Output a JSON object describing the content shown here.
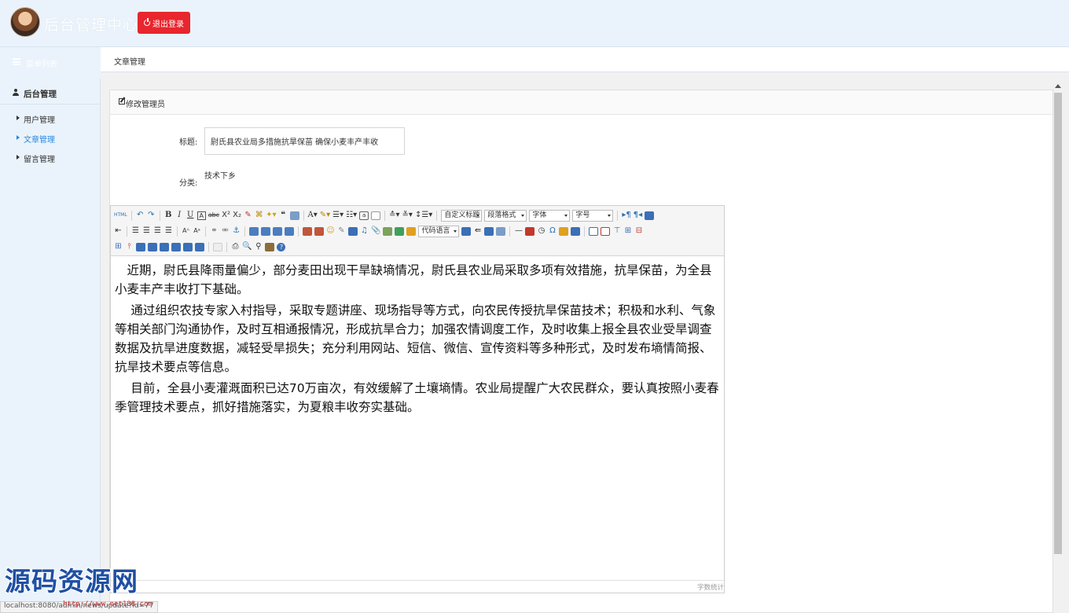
{
  "header": {
    "app_title": "后台管理中心",
    "logout_label": "退出登录",
    "logout_color": "#e7262e"
  },
  "sidebar_header": {
    "label": "菜单列表"
  },
  "breadcrumb": {
    "current": "文章管理"
  },
  "sidebar": {
    "section_label": "后台管理",
    "items": [
      {
        "label": "用户管理",
        "active": false
      },
      {
        "label": "文章管理",
        "active": true
      },
      {
        "label": "留言管理",
        "active": false
      }
    ],
    "active_color": "#2a8ae0"
  },
  "panel": {
    "title": "修改管理员"
  },
  "form": {
    "title_label": "标题:",
    "title_value": "尉氏县农业局多措施抗旱保苗 确保小麦丰产丰收",
    "category_label": "分类:",
    "category_value": "技术下乡"
  },
  "editor": {
    "toolbar": {
      "html_label": "HTML",
      "custom_title": "自定义标题",
      "paragraph_format": "段落格式",
      "font_family": "字体",
      "font_size": "字号",
      "code_language": "代码语言"
    },
    "paragraphs": [
      "　近期，尉氏县降雨量偏少，部分麦田出现干旱缺墒情况，尉氏县农业局采取多项有效措施，抗旱保苗，为全县小麦丰产丰收打下基础。",
      "　 通过组织农技专家入村指导，采取专题讲座、现场指导等方式，向农民传授抗旱保苗技术；积极和水利、气象等相关部门沟通协作，及时互相通报情况，形成抗旱合力；加强农情调度工作，及时收集上报全县农业受旱调查数据及抗旱进度数据，减轻受旱损失；充分利用网站、短信、微信、宣传资料等多种形式，及时发布墒情简报、抗旱技术要点等信息。",
      "　 目前，全县小麦灌溉面积已达70万亩次，有效缓解了土壤墒情。农业局提醒广大农民群众，要认真按照小麦春季管理技术要点，抓好措施落实，为夏粮丰收夯实基础。"
    ],
    "word_count_label": "字数统计"
  },
  "watermark": {
    "text": "源码资源网",
    "url": "http://www.net188.com"
  },
  "status_bar": {
    "url": "localhost:8080/admin/news/update?id=77"
  }
}
